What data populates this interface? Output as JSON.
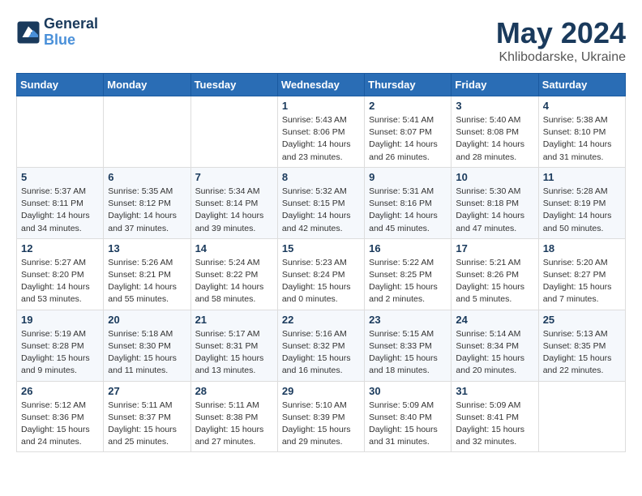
{
  "header": {
    "logo_line1": "General",
    "logo_line2": "Blue",
    "month": "May 2024",
    "location": "Khlibodarske, Ukraine"
  },
  "days_of_week": [
    "Sunday",
    "Monday",
    "Tuesday",
    "Wednesday",
    "Thursday",
    "Friday",
    "Saturday"
  ],
  "weeks": [
    [
      {
        "day": "",
        "info": ""
      },
      {
        "day": "",
        "info": ""
      },
      {
        "day": "",
        "info": ""
      },
      {
        "day": "1",
        "info": "Sunrise: 5:43 AM\nSunset: 8:06 PM\nDaylight: 14 hours\nand 23 minutes."
      },
      {
        "day": "2",
        "info": "Sunrise: 5:41 AM\nSunset: 8:07 PM\nDaylight: 14 hours\nand 26 minutes."
      },
      {
        "day": "3",
        "info": "Sunrise: 5:40 AM\nSunset: 8:08 PM\nDaylight: 14 hours\nand 28 minutes."
      },
      {
        "day": "4",
        "info": "Sunrise: 5:38 AM\nSunset: 8:10 PM\nDaylight: 14 hours\nand 31 minutes."
      }
    ],
    [
      {
        "day": "5",
        "info": "Sunrise: 5:37 AM\nSunset: 8:11 PM\nDaylight: 14 hours\nand 34 minutes."
      },
      {
        "day": "6",
        "info": "Sunrise: 5:35 AM\nSunset: 8:12 PM\nDaylight: 14 hours\nand 37 minutes."
      },
      {
        "day": "7",
        "info": "Sunrise: 5:34 AM\nSunset: 8:14 PM\nDaylight: 14 hours\nand 39 minutes."
      },
      {
        "day": "8",
        "info": "Sunrise: 5:32 AM\nSunset: 8:15 PM\nDaylight: 14 hours\nand 42 minutes."
      },
      {
        "day": "9",
        "info": "Sunrise: 5:31 AM\nSunset: 8:16 PM\nDaylight: 14 hours\nand 45 minutes."
      },
      {
        "day": "10",
        "info": "Sunrise: 5:30 AM\nSunset: 8:18 PM\nDaylight: 14 hours\nand 47 minutes."
      },
      {
        "day": "11",
        "info": "Sunrise: 5:28 AM\nSunset: 8:19 PM\nDaylight: 14 hours\nand 50 minutes."
      }
    ],
    [
      {
        "day": "12",
        "info": "Sunrise: 5:27 AM\nSunset: 8:20 PM\nDaylight: 14 hours\nand 53 minutes."
      },
      {
        "day": "13",
        "info": "Sunrise: 5:26 AM\nSunset: 8:21 PM\nDaylight: 14 hours\nand 55 minutes."
      },
      {
        "day": "14",
        "info": "Sunrise: 5:24 AM\nSunset: 8:22 PM\nDaylight: 14 hours\nand 58 minutes."
      },
      {
        "day": "15",
        "info": "Sunrise: 5:23 AM\nSunset: 8:24 PM\nDaylight: 15 hours\nand 0 minutes."
      },
      {
        "day": "16",
        "info": "Sunrise: 5:22 AM\nSunset: 8:25 PM\nDaylight: 15 hours\nand 2 minutes."
      },
      {
        "day": "17",
        "info": "Sunrise: 5:21 AM\nSunset: 8:26 PM\nDaylight: 15 hours\nand 5 minutes."
      },
      {
        "day": "18",
        "info": "Sunrise: 5:20 AM\nSunset: 8:27 PM\nDaylight: 15 hours\nand 7 minutes."
      }
    ],
    [
      {
        "day": "19",
        "info": "Sunrise: 5:19 AM\nSunset: 8:28 PM\nDaylight: 15 hours\nand 9 minutes."
      },
      {
        "day": "20",
        "info": "Sunrise: 5:18 AM\nSunset: 8:30 PM\nDaylight: 15 hours\nand 11 minutes."
      },
      {
        "day": "21",
        "info": "Sunrise: 5:17 AM\nSunset: 8:31 PM\nDaylight: 15 hours\nand 13 minutes."
      },
      {
        "day": "22",
        "info": "Sunrise: 5:16 AM\nSunset: 8:32 PM\nDaylight: 15 hours\nand 16 minutes."
      },
      {
        "day": "23",
        "info": "Sunrise: 5:15 AM\nSunset: 8:33 PM\nDaylight: 15 hours\nand 18 minutes."
      },
      {
        "day": "24",
        "info": "Sunrise: 5:14 AM\nSunset: 8:34 PM\nDaylight: 15 hours\nand 20 minutes."
      },
      {
        "day": "25",
        "info": "Sunrise: 5:13 AM\nSunset: 8:35 PM\nDaylight: 15 hours\nand 22 minutes."
      }
    ],
    [
      {
        "day": "26",
        "info": "Sunrise: 5:12 AM\nSunset: 8:36 PM\nDaylight: 15 hours\nand 24 minutes."
      },
      {
        "day": "27",
        "info": "Sunrise: 5:11 AM\nSunset: 8:37 PM\nDaylight: 15 hours\nand 25 minutes."
      },
      {
        "day": "28",
        "info": "Sunrise: 5:11 AM\nSunset: 8:38 PM\nDaylight: 15 hours\nand 27 minutes."
      },
      {
        "day": "29",
        "info": "Sunrise: 5:10 AM\nSunset: 8:39 PM\nDaylight: 15 hours\nand 29 minutes."
      },
      {
        "day": "30",
        "info": "Sunrise: 5:09 AM\nSunset: 8:40 PM\nDaylight: 15 hours\nand 31 minutes."
      },
      {
        "day": "31",
        "info": "Sunrise: 5:09 AM\nSunset: 8:41 PM\nDaylight: 15 hours\nand 32 minutes."
      },
      {
        "day": "",
        "info": ""
      }
    ]
  ]
}
